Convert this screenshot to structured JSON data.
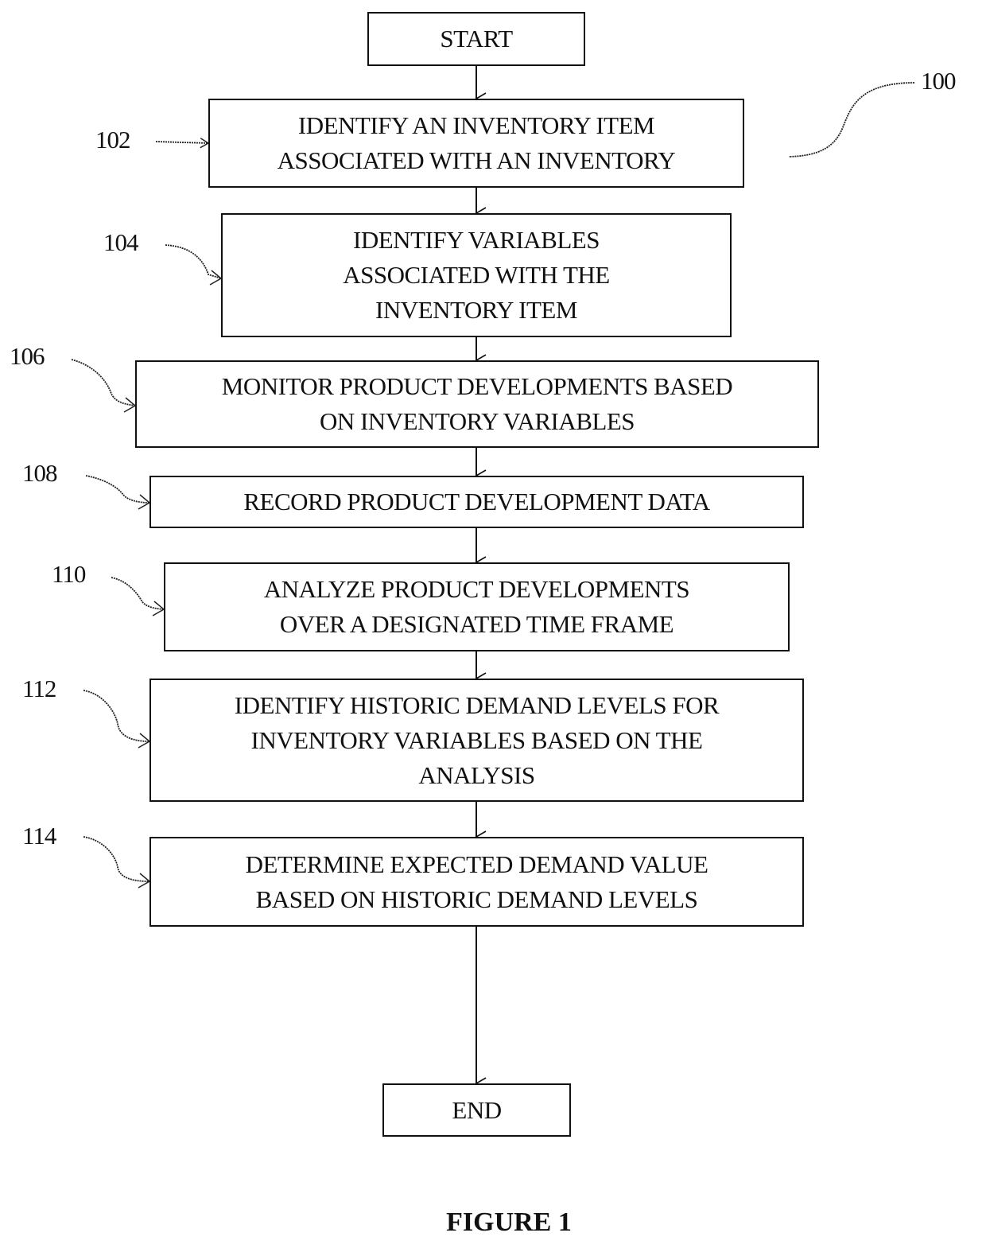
{
  "figure": {
    "caption": "FIGURE 1",
    "overall_ref": "100"
  },
  "flowchart": {
    "start_label": "START",
    "end_label": "END",
    "steps": [
      {
        "ref": "102",
        "text": "IDENTIFY AN INVENTORY ITEM\nASSOCIATED WITH AN INVENTORY"
      },
      {
        "ref": "104",
        "text": "IDENTIFY VARIABLES\nASSOCIATED WITH THE\nINVENTORY ITEM"
      },
      {
        "ref": "106",
        "text": "MONITOR PRODUCT DEVELOPMENTS BASED\nON INVENTORY VARIABLES"
      },
      {
        "ref": "108",
        "text": "RECORD PRODUCT DEVELOPMENT DATA"
      },
      {
        "ref": "110",
        "text": "ANALYZE PRODUCT DEVELOPMENTS\nOVER A DESIGNATED TIME FRAME"
      },
      {
        "ref": "112",
        "text": "IDENTIFY HISTORIC DEMAND LEVELS FOR\nINVENTORY VARIABLES BASED ON THE\nANALYSIS"
      },
      {
        "ref": "114",
        "text": "DETERMINE EXPECTED DEMAND VALUE\nBASED ON HISTORIC DEMAND LEVELS"
      }
    ]
  }
}
